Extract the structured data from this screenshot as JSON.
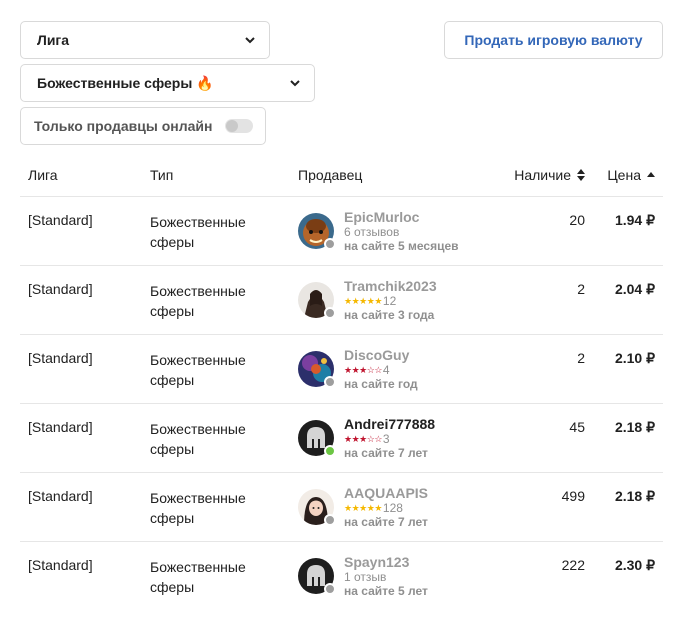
{
  "filters": {
    "league_select": "Лига",
    "currency_select": "Божественные сферы 🔥",
    "online_only_label": "Только продавцы онлайн",
    "online_only_enabled": false,
    "sell_button": "Продать игровую валюту"
  },
  "table": {
    "headers": {
      "league": "Лига",
      "type": "Тип",
      "seller": "Продавец",
      "stock": "Наличие",
      "price": "Цена"
    },
    "rows": [
      {
        "league": "[Standard]",
        "type": "Божественные сферы",
        "seller_name": "EpicMurloc",
        "reviews": "6 отзывов",
        "rating": null,
        "review_count": "",
        "since": "на сайте 5 месяцев",
        "online": false,
        "stock": "20",
        "price": "1.94 ₽"
      },
      {
        "league": "[Standard]",
        "type": "Божественные сферы",
        "seller_name": "Tramchik2023",
        "reviews": "",
        "rating": 5,
        "review_count": "12",
        "since": "на сайте 3 года",
        "online": false,
        "stock": "2",
        "price": "2.04 ₽"
      },
      {
        "league": "[Standard]",
        "type": "Божественные сферы",
        "seller_name": "DiscoGuy",
        "reviews": "",
        "rating": 3,
        "review_count": "4",
        "since": "на сайте год",
        "online": false,
        "stock": "2",
        "price": "2.10 ₽"
      },
      {
        "league": "[Standard]",
        "type": "Божественные сферы",
        "seller_name": "Andrei777888",
        "reviews": "",
        "rating": 3,
        "review_count": "3",
        "since": "на сайте 7 лет",
        "online": true,
        "stock": "45",
        "price": "2.18 ₽"
      },
      {
        "league": "[Standard]",
        "type": "Божественные сферы",
        "seller_name": "AAQUAAPIS",
        "reviews": "",
        "rating": 5,
        "review_count": "128",
        "since": "на сайте 7 лет",
        "online": false,
        "stock": "499",
        "price": "2.18 ₽"
      },
      {
        "league": "[Standard]",
        "type": "Божественные сферы",
        "seller_name": "Spayn123",
        "reviews": "1 отзыв",
        "rating": null,
        "review_count": "",
        "since": "на сайте 5 лет",
        "online": false,
        "stock": "222",
        "price": "2.30 ₽"
      }
    ]
  },
  "colors": {
    "accent": "#3367b8",
    "star_gold": "#f5b800",
    "star_red": "#c0152f",
    "online": "#6cc644",
    "offline": "#9e9e9e"
  },
  "avatars": [
    "orc-avatar",
    "warrior-avatar",
    "mage-avatar",
    "helmet-avatar",
    "girl-avatar",
    "helmet-avatar"
  ]
}
